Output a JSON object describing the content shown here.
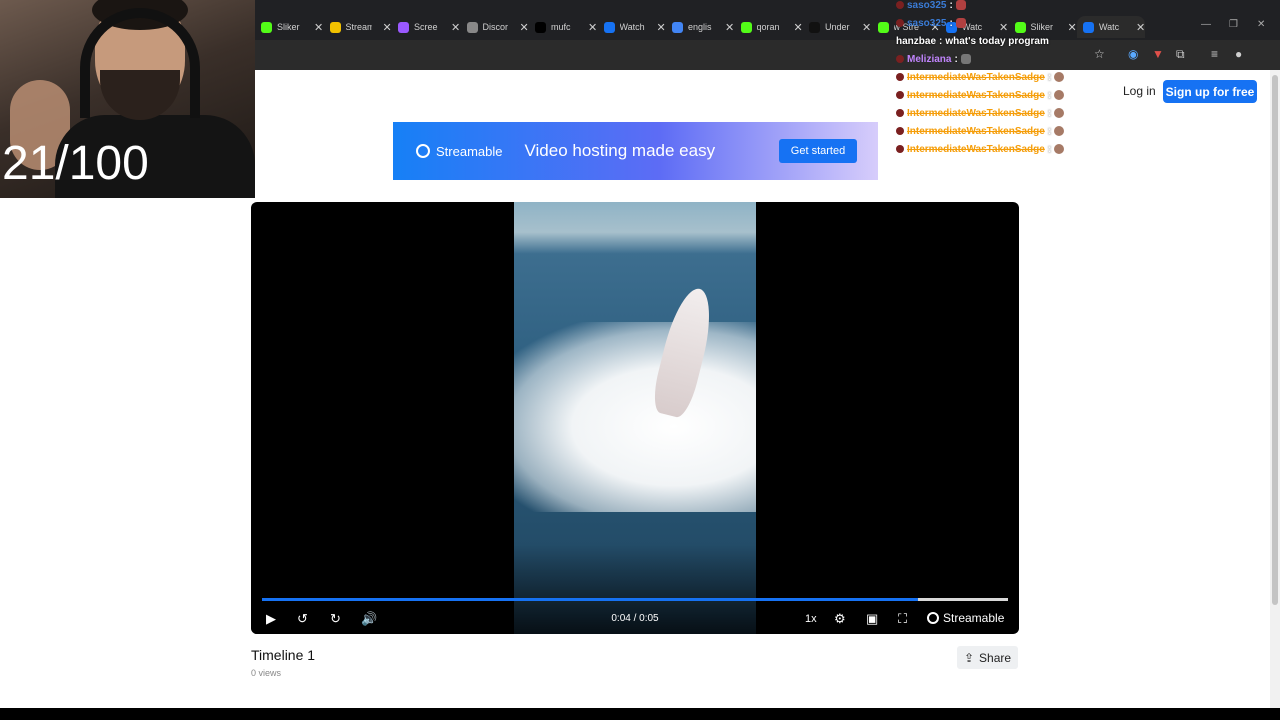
{
  "browser": {
    "tabs": [
      {
        "title": "Sliker",
        "color": "#53fc18"
      },
      {
        "title": "Stream",
        "color": "#f2c200"
      },
      {
        "title": "Scree",
        "color": "#9b59ff"
      },
      {
        "title": "Discor",
        "color": "#888888"
      },
      {
        "title": "mufc",
        "color": "#000000"
      },
      {
        "title": "Watch",
        "color": "#1672f3"
      },
      {
        "title": "englis",
        "color": "#4285f4"
      },
      {
        "title": "qoran",
        "color": "#53fc18"
      },
      {
        "title": "Under",
        "color": "#111111"
      },
      {
        "title": "w Stre",
        "color": "#53fc18"
      },
      {
        "title": "Watc",
        "color": "#1672f3"
      },
      {
        "title": "Sliker",
        "color": "#53fc18"
      },
      {
        "title": "Watc",
        "color": "#1672f3"
      }
    ],
    "close_glyph": "✕",
    "new_tab_glyph": "+",
    "minimize_glyph": "—",
    "restore_glyph": "❐",
    "window_close_glyph": "✕"
  },
  "overlay": {
    "counter": "21/100",
    "chat": [
      {
        "user": "saso325",
        "sep": " :",
        "message": "",
        "user_style": "blue",
        "emote": "red"
      },
      {
        "user": "saso325",
        "sep": " :",
        "message": "",
        "user_style": "blue",
        "emote": "red"
      },
      {
        "user": "hanzbae",
        "sep": " :",
        "message": " what's today program",
        "user_style": "white",
        "emote": ""
      },
      {
        "user": "Meliziana",
        "sep": " :",
        "message": "",
        "user_style": "purple",
        "emote": "grey"
      },
      {
        "user": "IntermediateWasTakenSadge",
        "sep": " :",
        "message": "",
        "user_style": "orange",
        "emote": "face"
      },
      {
        "user": "IntermediateWasTakenSadge",
        "sep": " :",
        "message": "",
        "user_style": "orange",
        "emote": "face"
      },
      {
        "user": "IntermediateWasTakenSadge",
        "sep": " :",
        "message": "",
        "user_style": "orange",
        "emote": "face"
      },
      {
        "user": "IntermediateWasTakenSadge",
        "sep": " :",
        "message": "",
        "user_style": "orange",
        "emote": "face"
      },
      {
        "user": "IntermediateWasTakenSadge",
        "sep": " :",
        "message": "",
        "user_style": "orange",
        "emote": "face"
      }
    ]
  },
  "header": {
    "login_label": "Log in",
    "signup_label": "Sign up for free"
  },
  "banner": {
    "logo_text": "Streamable",
    "tagline": "Video hosting made easy",
    "cta_label": "Get started"
  },
  "player": {
    "time": "0:04 / 0:05",
    "progress_fraction": 0.88,
    "speed": "1x",
    "brand": "Streamable",
    "play_glyph": "▶",
    "rewind_glyph": "↺",
    "forward_glyph": "↻",
    "volume_glyph": "🔊",
    "settings_glyph": "⚙",
    "pip_glyph": "▣",
    "fullscreen_glyph": "⛶"
  },
  "video": {
    "title": "Timeline 1",
    "views": "0 views",
    "share_label": "Share",
    "share_glyph": "⇪"
  }
}
